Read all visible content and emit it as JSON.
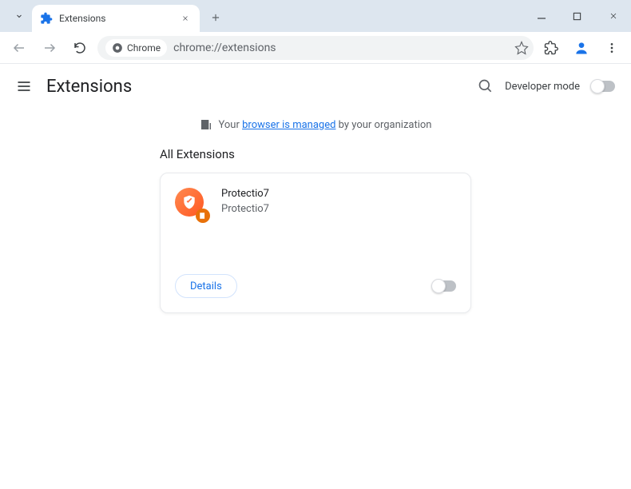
{
  "tab": {
    "title": "Extensions"
  },
  "omnibox": {
    "chip_label": "Chrome",
    "url": "chrome://extensions"
  },
  "header": {
    "title": "Extensions",
    "dev_mode_label": "Developer mode"
  },
  "managed": {
    "prefix": "Your ",
    "link": "browser is managed",
    "suffix": " by your organization"
  },
  "section": {
    "title": "All Extensions"
  },
  "extension": {
    "name": "Protectio7",
    "description": "Protectio7",
    "details_label": "Details"
  }
}
